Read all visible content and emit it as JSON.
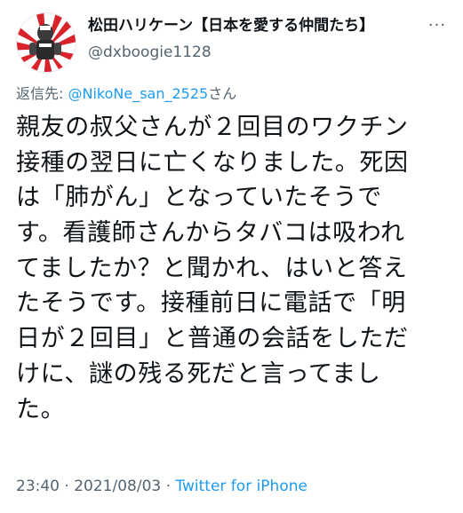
{
  "author": {
    "display_name": "松田ハリケーン【日本を愛する仲間たち】",
    "handle": "@dxboogie1128",
    "avatar_icon": "avatar-rising-sun-icon"
  },
  "more_icon": "more-dots-icon",
  "reply": {
    "prefix": "返信先: ",
    "mention": "@NikoNe_san_2525",
    "suffix": "さん"
  },
  "body_lines": [
    "親友の叔父さんが２回目のワクチン",
    "接種の翌日に亡くなりました。死因",
    "は「肺がん」となっていたそうで",
    "す。看護師さんからタバコは吸われ",
    "てましたか？と聞かれ、はいと答え",
    "たそうです。接種前日に電話で「明",
    "日が２回目」と普通の会話をしただ",
    "けに、謎の残る死だと言ってまし",
    "た。"
  ],
  "meta": {
    "time": "23:40",
    "separator1": " · ",
    "date": "2021/08/03",
    "separator2": " · ",
    "source": "Twitter for iPhone"
  },
  "colors": {
    "text": "#0f1419",
    "secondary": "#536471",
    "link": "#1d9bf0",
    "flag_red": "#d8232a"
  }
}
